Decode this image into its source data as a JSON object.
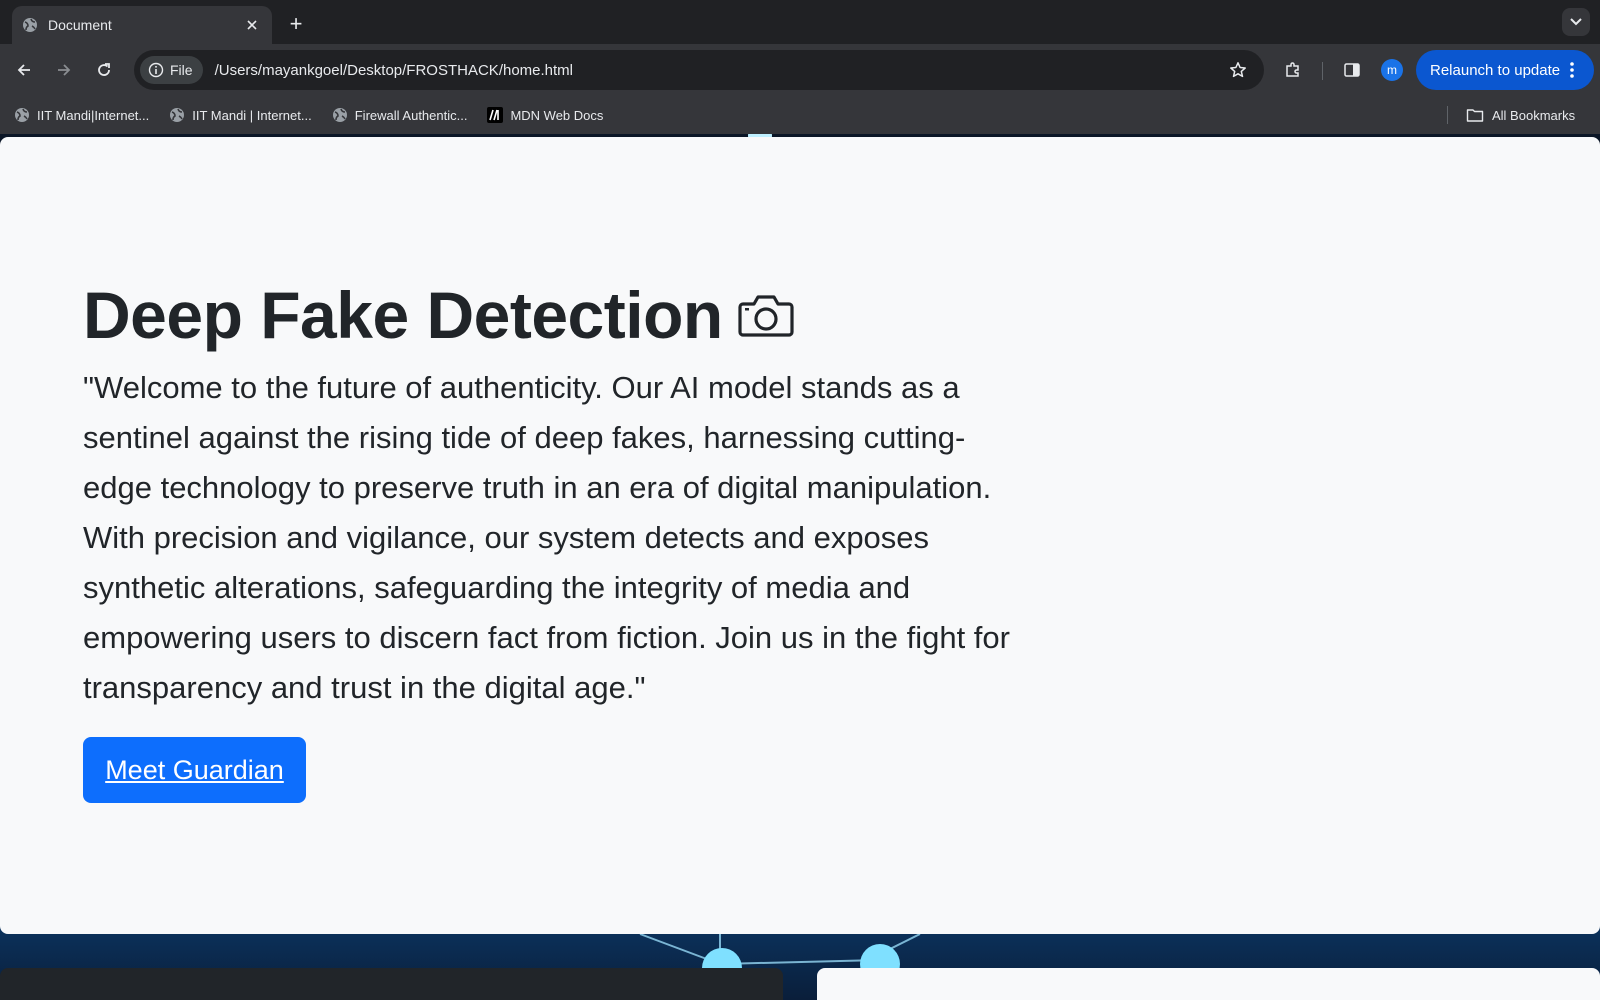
{
  "browser": {
    "tab": {
      "title": "Document",
      "favicon": "globe-icon",
      "close_icon": "close-icon"
    },
    "new_tab_label": "+",
    "omnibox": {
      "chip_label": "File",
      "url": "/Users/mayankgoel/Desktop/FROSTHACK/home.html"
    },
    "profile_initial": "m",
    "relaunch_label": "Relaunch to update",
    "bookmarks": [
      {
        "label": "IIT Mandi|Internet...",
        "icon": "globe-icon"
      },
      {
        "label": "IIT Mandi | Internet...",
        "icon": "globe-icon"
      },
      {
        "label": "Firewall Authentic...",
        "icon": "globe-icon"
      },
      {
        "label": "MDN Web Docs",
        "icon": "mdn-icon"
      }
    ],
    "all_bookmarks_label": "All Bookmarks"
  },
  "page": {
    "heading": "Deep Fake Detection",
    "heading_icon": "camera-icon",
    "description": "\"Welcome to the future of authenticity. Our AI model stands as a sentinel against the rising tide of deep fakes, harnessing cutting-edge technology to preserve truth in an era of digital manipulation. With precision and vigilance, our system detects and exposes synthetic alterations, safeguarding the integrity of media and empowering users to discern fact from fiction. Join us in the fight for transparency and trust in the digital age.\"",
    "cta_label": "Meet Guardian"
  },
  "colors": {
    "browser_frame": "#202124",
    "toolbar": "#35363a",
    "relaunch_button": "#0b57d0",
    "hero_background": "#f8f9fa",
    "heading_text": "#212529",
    "cta_button": "#0d6efd"
  }
}
